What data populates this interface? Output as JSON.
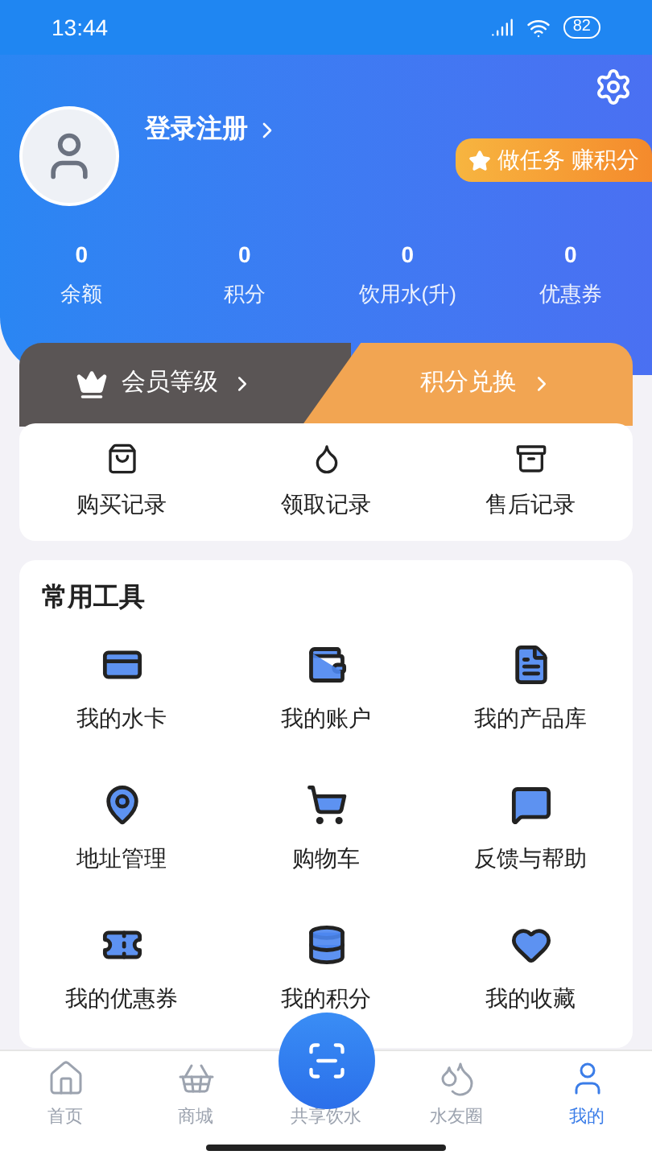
{
  "status_bar": {
    "time": "13:44",
    "battery": "82"
  },
  "profile": {
    "login": "登录注册",
    "task_button": "做任务 赚积分"
  },
  "stats": [
    {
      "value": "0",
      "label": "余额"
    },
    {
      "value": "0",
      "label": "积分"
    },
    {
      "value": "0",
      "label": "饮用水(升)"
    },
    {
      "value": "0",
      "label": "优惠券"
    }
  ],
  "member_bar": {
    "level": "会员等级",
    "exchange": "积分兑换"
  },
  "records": [
    {
      "label": "购买记录"
    },
    {
      "label": "领取记录"
    },
    {
      "label": "售后记录"
    }
  ],
  "tools": {
    "title": "常用工具",
    "items": [
      {
        "label": "我的水卡"
      },
      {
        "label": "我的账户"
      },
      {
        "label": "我的产品库"
      },
      {
        "label": "地址管理"
      },
      {
        "label": "购物车"
      },
      {
        "label": "反馈与帮助"
      },
      {
        "label": "我的优惠券"
      },
      {
        "label": "我的积分"
      },
      {
        "label": "我的收藏"
      }
    ]
  },
  "bottom_nav": [
    {
      "kind": "tab",
      "label": "首页",
      "selected": false
    },
    {
      "kind": "tab",
      "label": "商城",
      "selected": false
    },
    {
      "kind": "center",
      "label": "共享饮水",
      "selected": false
    },
    {
      "kind": "tab",
      "label": "水友圈",
      "selected": false
    },
    {
      "kind": "tab",
      "label": "我的",
      "selected": true
    }
  ]
}
